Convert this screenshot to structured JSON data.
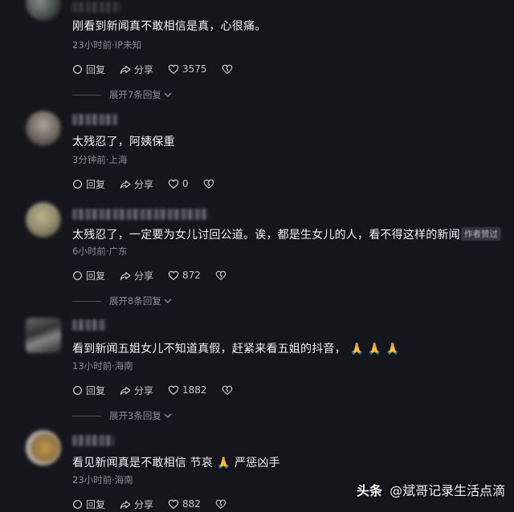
{
  "comments": [
    {
      "text": "刚看到新闻真不敢相信是真，心很痛。",
      "meta": "23小时前·IP未知",
      "reply": "回复",
      "share": "分享",
      "likes": "3575",
      "expand": "展开7条回复"
    },
    {
      "text": "太残忍了，阿姨保重",
      "meta": "3分钟前·上海",
      "reply": "回复",
      "share": "分享",
      "likes": "0",
      "expand": ""
    },
    {
      "text": "太残忍了，一定要为女儿讨回公道。诶，都是生女儿的人，看不得这样的新闻",
      "meta": "6小时前·广东",
      "reply": "回复",
      "share": "分享",
      "likes": "872",
      "expand": "展开8条回复",
      "tag": "作者赞过"
    },
    {
      "text": "看到新闻五姐女儿不知道真假，赶紧来看五姐的抖音，",
      "emoji": "🙏 🙏 🙏",
      "meta": "13小时前·海南",
      "reply": "回复",
      "share": "分享",
      "likes": "1882",
      "expand": "展开3条回复"
    },
    {
      "text": "看见新闻真是不敢相信 节哀",
      "emoji": "🙏",
      "text2": "严惩凶手",
      "meta": "23小时前·海南",
      "reply": "回复",
      "share": "分享",
      "likes": "882",
      "expand": ""
    }
  ],
  "watermark": {
    "brand": "头条",
    "account": "@斌哥记录生活点滴"
  },
  "colors": {
    "background": "#15161b",
    "text": "#f0f0f2",
    "meta": "#8b8c95"
  },
  "icons": [
    "comment-icon",
    "share-icon",
    "heart-icon",
    "broken-heart-icon",
    "chevron-down-icon"
  ]
}
